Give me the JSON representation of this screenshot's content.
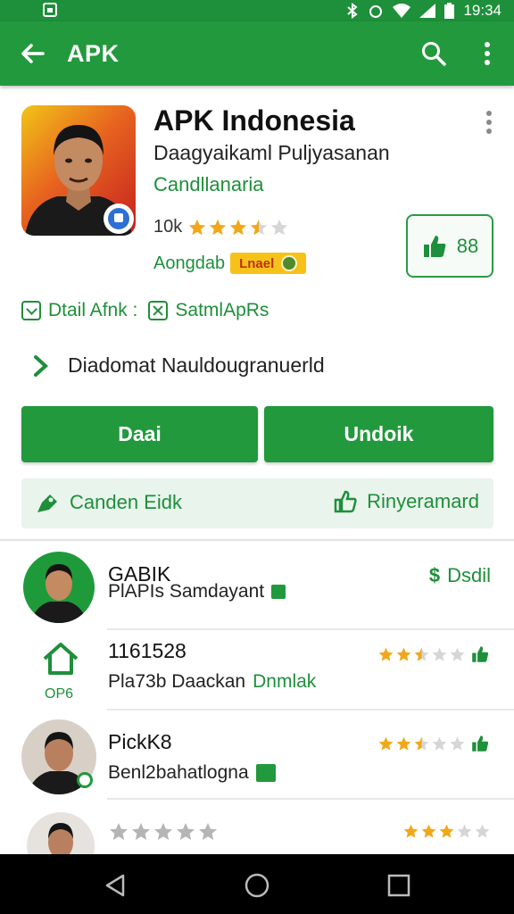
{
  "status_bar": {
    "time": "19:34"
  },
  "app_bar": {
    "title": "APK"
  },
  "app": {
    "name": "APK Indonesia",
    "developer": "Daagyaikaml Puljyasanan",
    "category": "Candllanaria",
    "rating_count": "10k",
    "rating": 3.5,
    "ad_label": "Aongdab",
    "ad_tag": "Lnael",
    "like_count": "88"
  },
  "meta": {
    "detail_label": "Dtail Afnk :",
    "secondary_label": "SatmlApRs"
  },
  "description": {
    "text": "Diadomat Nauldougranuerld"
  },
  "buttons": {
    "left_label": "Daai",
    "right_label": "Undoik"
  },
  "actions": {
    "left_label": "Canden Eidk",
    "right_label": "Rinyeramard"
  },
  "list": [
    {
      "title": "GABIK",
      "subtitle": "PlAPIs Samdayant",
      "right_label": "Dsdil"
    },
    {
      "title": "1161528",
      "subtitle_prefix": "Pla73b Daackan",
      "subtitle_highlight": "Dnmlak",
      "icon_caption": "OP6",
      "rating": 2.5
    },
    {
      "title": "PickK8",
      "subtitle": "Benl2bahatlogna",
      "rating": 2.5
    },
    {
      "rating_left": 0,
      "rating": 3
    }
  ],
  "colors": {
    "primary": "#22993d",
    "accent_text": "#1e8f3a",
    "star": "#f0a81a"
  }
}
